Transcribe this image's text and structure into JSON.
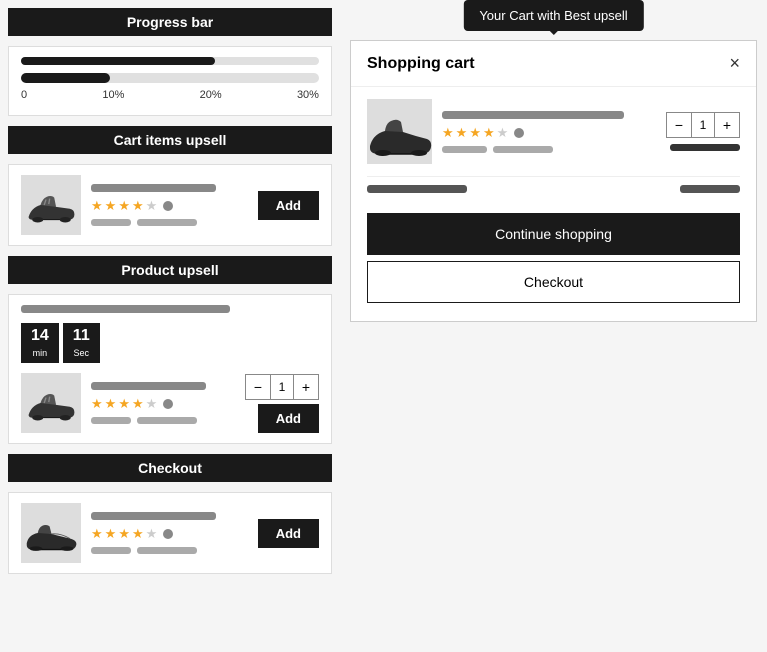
{
  "left": {
    "sections": [
      {
        "id": "progress-bar",
        "header": "Progress bar",
        "progress_value": 30,
        "labels": [
          "0",
          "10%",
          "20%",
          "30%"
        ]
      },
      {
        "id": "cart-items-upsell",
        "header": "Cart items upsell",
        "product": {
          "rating": 4,
          "half_star": false,
          "title_bar_width": "80%",
          "price_bars": [
            40,
            60
          ]
        },
        "add_btn": "Add"
      },
      {
        "id": "product-upsell",
        "header": "Product upsell",
        "title_bar_width": "70%",
        "timer": {
          "min": 14,
          "sec": 11,
          "min_label": "min",
          "sec_label": "Sec"
        },
        "product": {
          "rating": 4,
          "price_bars": [
            40,
            60
          ]
        },
        "quantity": 1,
        "add_btn": "Add"
      },
      {
        "id": "checkout",
        "header": "Checkout",
        "product": {
          "rating": 4,
          "price_bars": [
            40,
            60
          ]
        },
        "add_btn": "Add"
      }
    ]
  },
  "right": {
    "tooltip": "Your Cart with Best upsell",
    "cart": {
      "title": "Shopping cart",
      "close_icon": "×",
      "item": {
        "rating": 4,
        "quantity": 1,
        "price_bar_w1": 70,
        "price_bar_w2": 50
      },
      "continue_shopping": "Continue shopping",
      "checkout": "Checkout"
    }
  }
}
